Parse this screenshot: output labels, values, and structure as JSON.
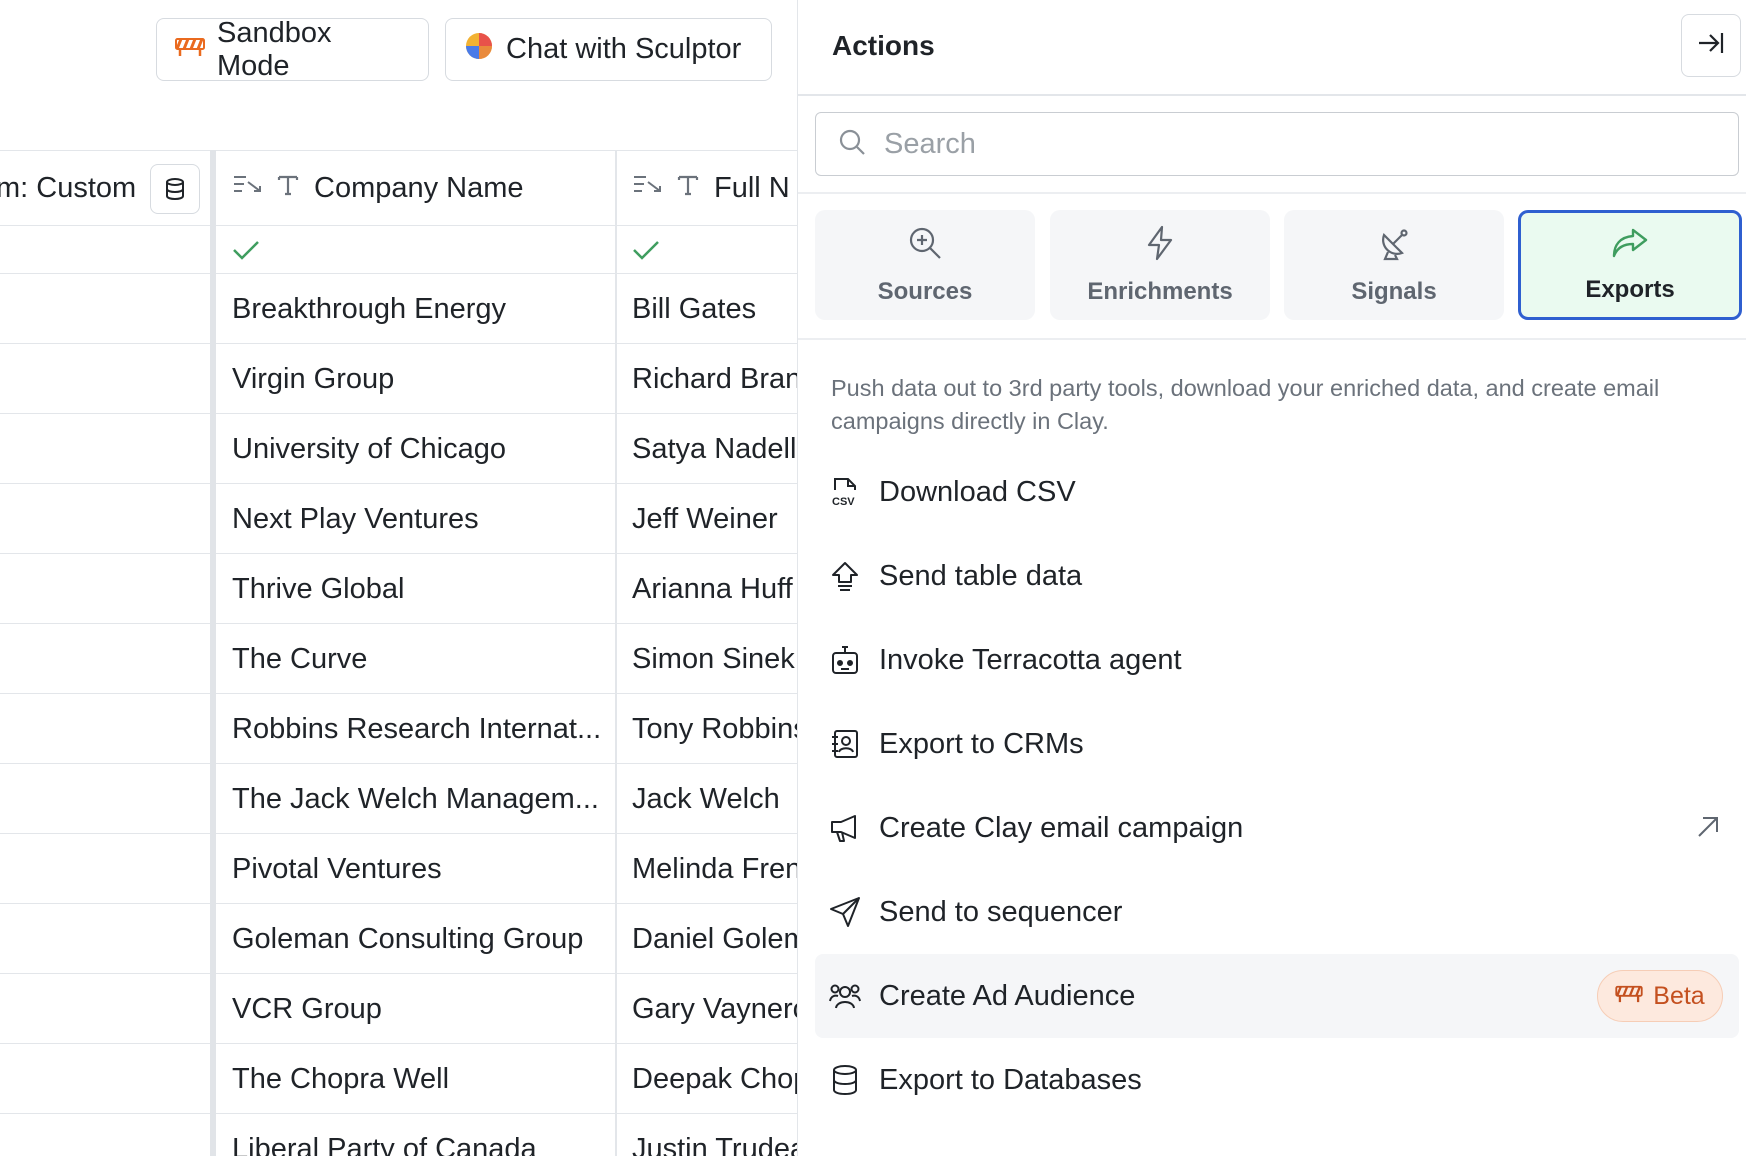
{
  "toolbar": {
    "sandbox_label": "Sandbox Mode",
    "chat_label": "Chat with Sculptor"
  },
  "table": {
    "headers": {
      "custom_visible": "m: Custom",
      "custom_faded": "",
      "company": "Company Name",
      "full": "Full N"
    },
    "rows": [
      {
        "company": "Breakthrough Energy",
        "full": "Bill Gates"
      },
      {
        "company": "Virgin Group",
        "full": "Richard Bran"
      },
      {
        "company": "University of Chicago",
        "full": "Satya Nadella"
      },
      {
        "company": "Next Play Ventures",
        "full": "Jeff Weiner"
      },
      {
        "company": "Thrive Global",
        "full": "Arianna Huff"
      },
      {
        "company": "The Curve",
        "full": "Simon Sinek"
      },
      {
        "company": "Robbins Research Internat...",
        "full": "Tony Robbins"
      },
      {
        "company": "The Jack Welch Managem...",
        "full": "Jack Welch"
      },
      {
        "company": "Pivotal Ventures",
        "full": "Melinda Fren"
      },
      {
        "company": "Goleman Consulting Group",
        "full": "Daniel Golem"
      },
      {
        "company": "VCR Group",
        "full": "Gary Vaynerc"
      },
      {
        "company": "The Chopra Well",
        "full": "Deepak Chop"
      },
      {
        "company": "Liberal Party of Canada",
        "full": "Justin Trudea"
      }
    ]
  },
  "panel": {
    "title": "Actions",
    "search_placeholder": "Search",
    "tabs": [
      {
        "label": "Sources",
        "icon": "search-plus-icon"
      },
      {
        "label": "Enrichments",
        "icon": "lightning-icon"
      },
      {
        "label": "Signals",
        "icon": "satellite-dish-icon"
      },
      {
        "label": "Exports",
        "icon": "share-arrow-icon",
        "selected": true
      }
    ],
    "description": "Push data out to 3rd party tools, download your enriched data, and create email campaigns directly in Clay.",
    "actions": [
      {
        "label": "Download CSV",
        "icon": "csv-file-icon"
      },
      {
        "label": "Send table data",
        "icon": "upload-icon"
      },
      {
        "label": "Invoke Terracotta agent",
        "icon": "robot-icon"
      },
      {
        "label": "Export to CRMs",
        "icon": "contact-book-icon"
      },
      {
        "label": "Create Clay email campaign",
        "icon": "megaphone-icon",
        "external": true
      },
      {
        "label": "Send to sequencer",
        "icon": "paper-plane-icon"
      },
      {
        "label": "Create Ad Audience",
        "icon": "users-icon",
        "badge": "Beta"
      },
      {
        "label": "Export to Databases",
        "icon": "database-icon"
      }
    ]
  },
  "colors": {
    "accent_border": "#2f5fd0",
    "export_tab_bg": "#eafaf0",
    "check_green": "#3f9d5f",
    "beta_text": "#c4501f"
  }
}
